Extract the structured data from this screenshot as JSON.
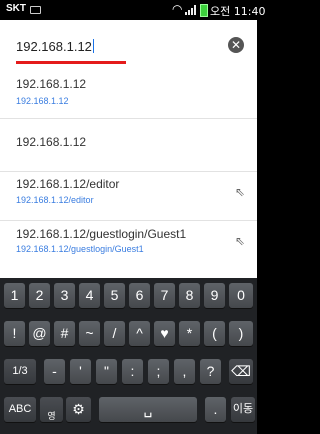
{
  "status_bar": {
    "carrier": "SKT",
    "time": "오전 11:40"
  },
  "url_bar": {
    "value": "192.168.1.12"
  },
  "suggestions": [
    {
      "title": "192.168.1.12",
      "subtitle": "192.168.1.12",
      "has_arrow": false
    },
    {
      "title": "192.168.1.12",
      "subtitle": "",
      "has_arrow": false
    },
    {
      "title": "192.168.1.12/editor",
      "subtitle": "192.168.1.12/editor",
      "has_arrow": true
    },
    {
      "title": "192.168.1.12/guestlogin/Guest1",
      "subtitle": "192.168.1.12/guestlogin/Guest1",
      "has_arrow": true
    }
  ],
  "keyboard": {
    "row1": [
      "1",
      "2",
      "3",
      "4",
      "5",
      "6",
      "7",
      "8",
      "9",
      "0"
    ],
    "row2": [
      "!",
      "@",
      "#",
      "~",
      "/",
      "^",
      "♥",
      "*",
      "(",
      ")"
    ],
    "row3": [
      "1/3",
      "-",
      "'",
      "\"",
      ":",
      ";",
      ",",
      "?"
    ],
    "row4": {
      "abc": "ABC",
      "lang": "영",
      "period": ".",
      "go": "이동"
    }
  },
  "colors": {
    "url_underline": "#e41b1b",
    "suggestion_link": "#3a7de0",
    "keyboard_bg": "#202225"
  }
}
